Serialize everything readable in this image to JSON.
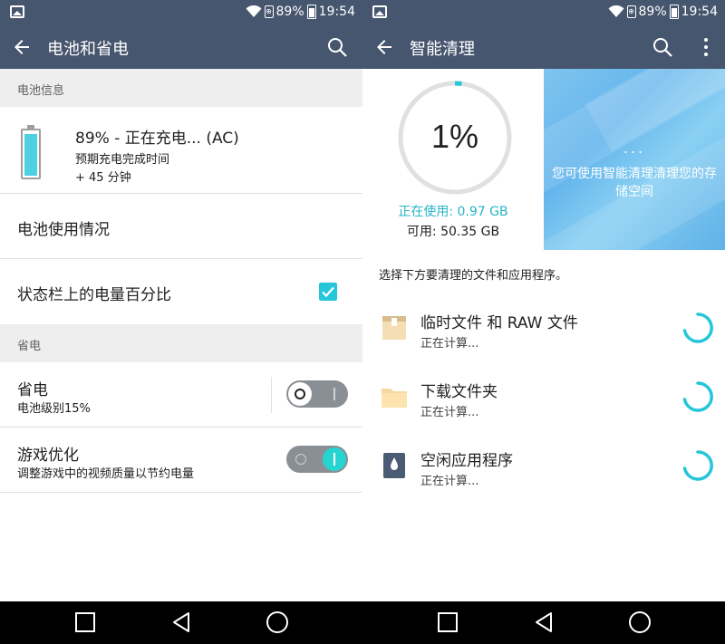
{
  "status_bar": {
    "battery_percent": "89%",
    "time": "19:54",
    "icons": [
      "image-icon",
      "wifi-icon",
      "data-saver-icon",
      "battery-icon"
    ]
  },
  "left": {
    "title": "电池和省电",
    "section_battery_info": "电池信息",
    "battery": {
      "level": 0.89,
      "status": "89% - 正在充电... (AC)",
      "estimate_label": "预期充电完成时间",
      "estimate_value": "+ 45 分钟"
    },
    "battery_usage": "电池使用情况",
    "status_bar_percent": "状态栏上的电量百分比",
    "status_bar_percent_checked": true,
    "section_power_saving": "省电",
    "power_saving": {
      "title": "省电",
      "subtitle": "电池级别15%",
      "enabled": false
    },
    "game_optimize": {
      "title": "游戏优化",
      "subtitle": "调整游戏中的视频质量以节约电量",
      "enabled": true
    }
  },
  "right": {
    "title": "智能清理",
    "storage": {
      "percent_label": "1%",
      "percent_value": 0.01,
      "used": "正在使用: 0.97 GB",
      "available": "可用: 50.35 GB"
    },
    "promo": {
      "dots": "...",
      "message": "您可使用智能清理清理您的存储空间"
    },
    "hint": "选择下方要清理的文件和应用程序。",
    "items": [
      {
        "title": "临时文件 和 RAW 文件",
        "status": "正在计算...",
        "icon": "temp-file-icon"
      },
      {
        "title": "下载文件夹",
        "status": "正在计算...",
        "icon": "folder-icon"
      },
      {
        "title": "空闲应用程序",
        "status": "正在计算...",
        "icon": "idle-app-icon"
      }
    ]
  },
  "colors": {
    "header": "#46566f",
    "accent": "#26c6da",
    "promo": "#6cb9ee"
  }
}
